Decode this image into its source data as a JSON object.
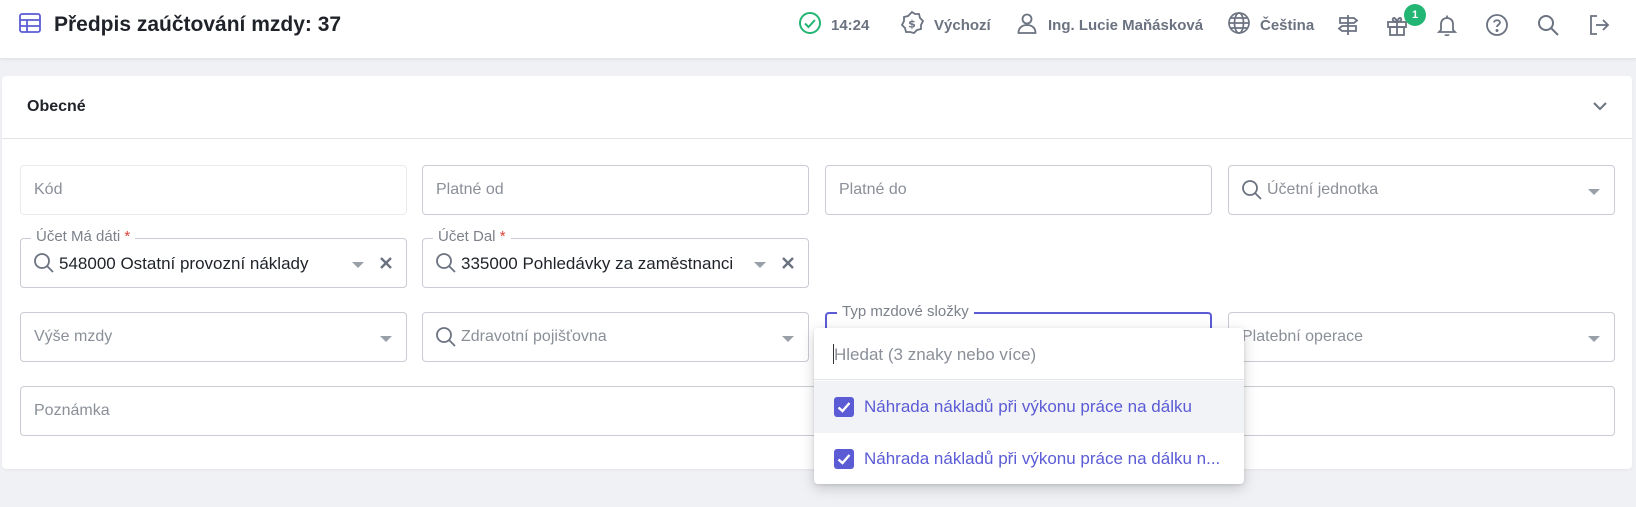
{
  "header": {
    "title": "Předpis zaúčtování mzdy: 37",
    "time": "14:24",
    "currency_label": "Výchozí",
    "user_name": "Ing. Lucie Maňásková",
    "language": "Čeština",
    "gift_badge": "1"
  },
  "section": {
    "title": "Obecné"
  },
  "fields": {
    "kod": {
      "placeholder": "Kód"
    },
    "platne_od": {
      "placeholder": "Platné od"
    },
    "platne_do": {
      "placeholder": "Platné do"
    },
    "ucetni_jednotka": {
      "placeholder": "Účetní jednotka"
    },
    "ucet_ma_dati": {
      "label": "Účet Má dáti",
      "required_mark": "*",
      "value": "548000 Ostatní provozní náklady"
    },
    "ucet_dal": {
      "label": "Účet Dal",
      "required_mark": "*",
      "value": "335000 Pohledávky za zaměstnanci"
    },
    "vyse_mzdy": {
      "placeholder": "Výše mzdy"
    },
    "zdravotni_pojistovna": {
      "placeholder": "Zdravotní pojišťovna"
    },
    "typ_mzdove_slozky": {
      "label": "Typ mzdové složky"
    },
    "platebni_operace": {
      "placeholder": "Platební operace"
    },
    "poznamka": {
      "placeholder": "Poznámka"
    }
  },
  "dropdown": {
    "search_placeholder": "Hledat (3 znaky nebo více)",
    "options": [
      {
        "label": "Náhrada nákladů při výkonu práce na dálku",
        "checked": true
      },
      {
        "label": "Náhrada nákladů při výkonu práce na dálku n...",
        "checked": true
      }
    ]
  },
  "colors": {
    "accent": "#5b5bd6",
    "success": "#22b573",
    "required": "#e0403a"
  }
}
